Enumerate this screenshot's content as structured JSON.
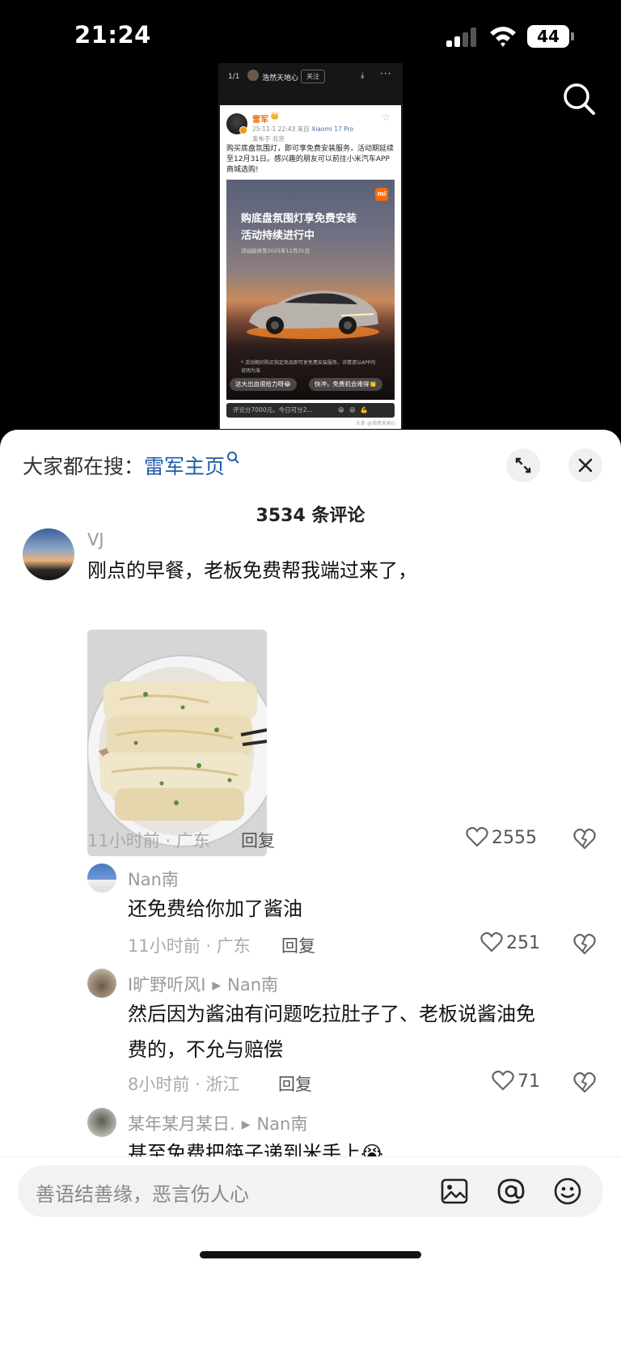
{
  "status_bar": {
    "time": "21:24",
    "battery": "44"
  },
  "post_screenshot": {
    "pager": "1/1",
    "author": "浩然天地心",
    "follow": "关注",
    "card": {
      "name": "雷军",
      "crown": "👑",
      "meta_time": "25-11-1 22:43",
      "meta_from": "来自",
      "meta_device": "Xiaomi 17 Pro",
      "location": "发布于 北京",
      "text": "购买底盘氛围灯，即可享免费安装服务，活动期延续至12月31日。感兴趣的朋友可以前往小米汽车APP商城选购!",
      "promo_logo": "mi",
      "promo_title_1": "购底盘氛围灯享免费安装",
      "promo_title_2": "活动持续进行中",
      "promo_sub": "活动延续至2025年12月31日",
      "promo_fine": "* 活动期间购买指定商品即可享免费安装服务，详情请以APP内说明为准",
      "pill_1": "这大出血很给力呀😂",
      "pill_2": "快冲，免费机会难得👏",
      "bottom_hint": "评论分7000元，今日可分2...",
      "bottom_emojis": "😁😆💪",
      "tag": "头条 @浩然天地心"
    }
  },
  "sheet": {
    "hot_search_prefix": "大家都在搜：",
    "hot_search_keyword": "雷军主页",
    "comment_count": "3534 条评论",
    "comments": [
      {
        "user": "VJ",
        "text": "刚点的早餐，老板免费帮我端过来了，",
        "meta": "11小时前 · 广东",
        "reply": "回复",
        "likes": "2555"
      }
    ],
    "replies": [
      {
        "user": "Nan南",
        "text": "还免费给你加了酱油",
        "meta": "11小时前 · 广东",
        "reply": "回复",
        "likes": "251"
      },
      {
        "user": "I旷野听风I",
        "reply_to": "Nan南",
        "text_1": "然后因为酱油有问题吃拉肚子了、老板说酱油免",
        "text_2": "费的，不允与赔偿",
        "meta": "8小时前 · 浙江",
        "reply": "回复",
        "likes": "71"
      },
      {
        "user": "某年某月某日.",
        "reply_to": "Nan南",
        "text": "甚至免费把筷子递到米手上😭"
      }
    ]
  },
  "input_bar": {
    "placeholder": "善语结善缘，恶言伤人心",
    "icons": [
      "image-icon",
      "at-icon",
      "emoji-icon"
    ]
  }
}
